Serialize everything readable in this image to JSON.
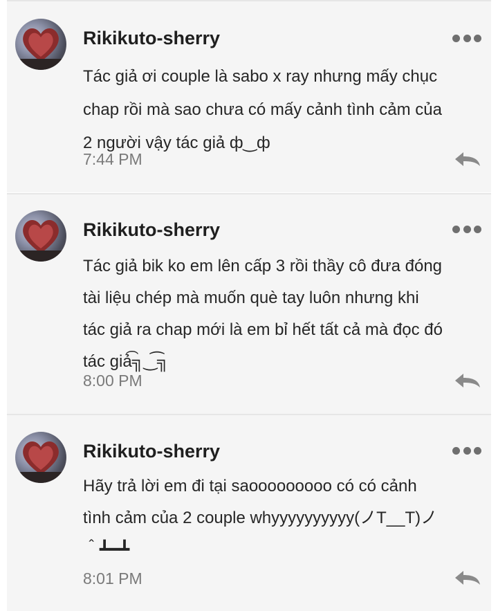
{
  "comments": [
    {
      "username": "Rikikuto-sherry",
      "text": "Tác giả ơi couple là sabo x ray nhưng mấy chục\nchap rồi mà sao chưa có mấy cảnh tình cảm của\n2 người vậy tác giả ф‿ф",
      "time": "7:44 PM",
      "more_icon": "more-horizontal-icon",
      "reply_icon": "reply-icon"
    },
    {
      "username": "Rikikuto-sherry",
      "text": "Tác giả bik ko em lên cấp 3 rồi thầy cô đưa đóng\ntài liệu chép mà muốn què tay luôn nhưng khi\ntác giả ra chap mới là em bỉ hết tất cả mà đọc đó\ntác giả͡╗‿͡╗",
      "time": "8:00 PM",
      "more_icon": "more-horizontal-icon",
      "reply_icon": "reply-icon"
    },
    {
      "username": "Rikikuto-sherry",
      "text": "Hãy trả lời em đi tại saooooooooo có có cảnh\ntình cảm của 2 couple whyyyyyyyyyy(ノT__T)ノ\n＾┻━┻",
      "time": "8:01 PM",
      "more_icon": "more-horizontal-icon",
      "reply_icon": "reply-icon"
    }
  ],
  "colors": {
    "panel_bg": "#f5f5f5",
    "username": "#1f1f1f",
    "text": "#262626",
    "timestamp": "#7a7a7a",
    "icon": "#6f6f6f"
  }
}
